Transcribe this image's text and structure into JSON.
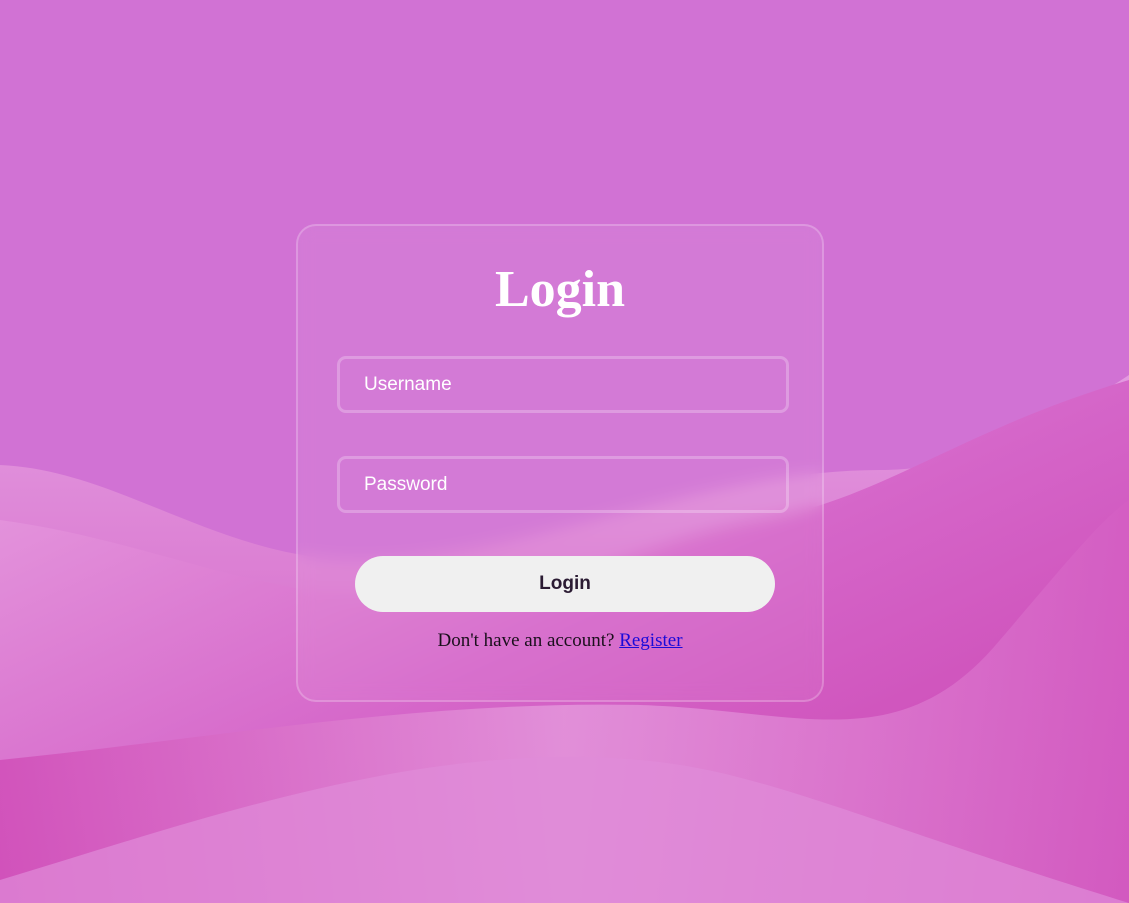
{
  "colors": {
    "background_top": "#d070d4",
    "fabric_light": "#e597dd",
    "fabric_dark": "#cc45b3",
    "button_bg": "#f0f0f0",
    "link": "#1a0ad9"
  },
  "login": {
    "title": "Login",
    "username_placeholder": "Username",
    "password_placeholder": "Password",
    "submit_label": "Login",
    "register_prompt": "Don't have an account?",
    "register_link": "Register"
  }
}
